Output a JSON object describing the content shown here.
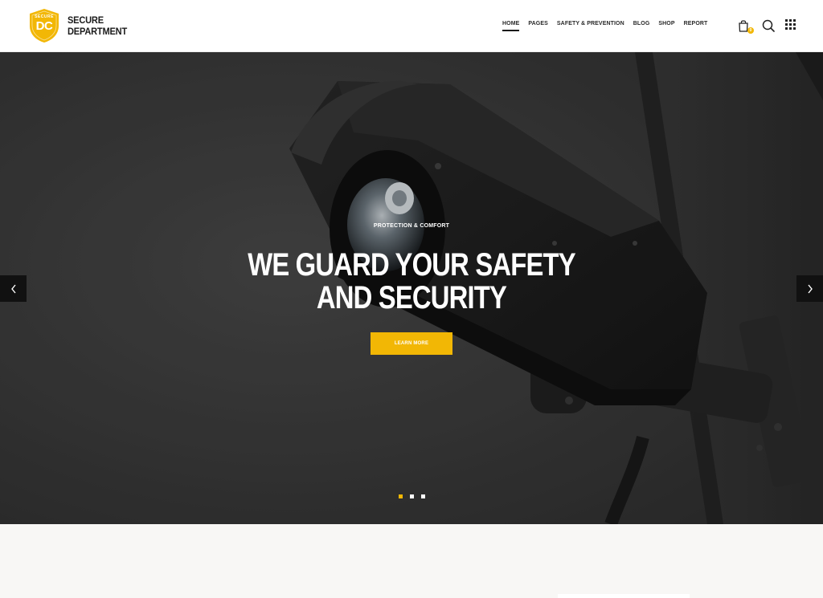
{
  "brand": {
    "logo_small": "SECURE",
    "logo_letters": "DC",
    "name_line1": "SECURE",
    "name_line2": "DEPARTMENT",
    "accent_color": "#f2b705"
  },
  "nav": {
    "items": [
      {
        "label": "HOME",
        "active": true
      },
      {
        "label": "PAGES",
        "active": false
      },
      {
        "label": "SAFETY & PREVENTION",
        "active": false
      },
      {
        "label": "BLOG",
        "active": false
      },
      {
        "label": "SHOP",
        "active": false
      },
      {
        "label": "REPORT",
        "active": false
      }
    ]
  },
  "header_icons": {
    "cart": "cart-icon",
    "cart_count": "0",
    "search": "search-icon",
    "menu": "grid-menu-icon"
  },
  "hero": {
    "eyebrow": "PROTECTION & COMFORT",
    "title_line1": "WE GUARD YOUR SAFETY",
    "title_line2": "AND SECURITY",
    "button_label": "LEARN MORE",
    "prev_icon": "chevron-left-icon",
    "next_icon": "chevron-right-icon",
    "slides": 3,
    "active_slide": 1
  }
}
